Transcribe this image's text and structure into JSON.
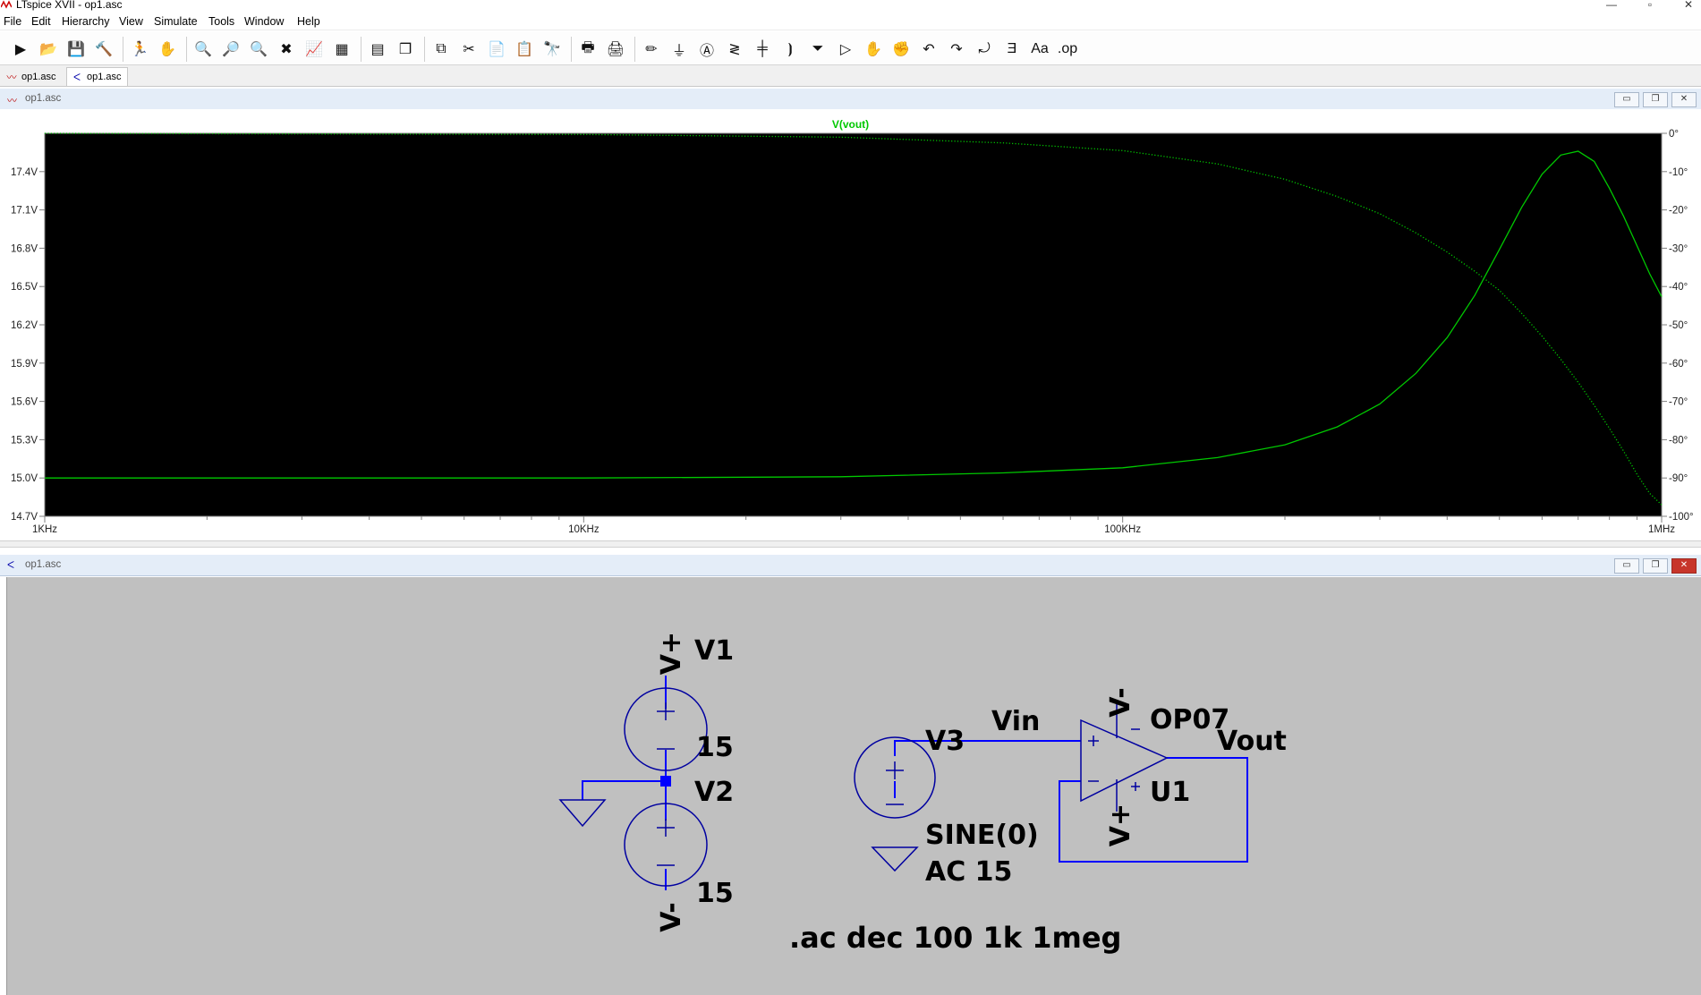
{
  "window": {
    "title": "LTspice XVII - op1.asc"
  },
  "menu": [
    "File",
    "Edit",
    "Hierarchy",
    "View",
    "Simulate",
    "Tools",
    "Window",
    "Help"
  ],
  "toolbar": {
    "buttons": [
      {
        "name": "run",
        "glyph": "▶"
      },
      {
        "name": "open",
        "glyph": "📂"
      },
      {
        "name": "save",
        "glyph": "💾"
      },
      {
        "name": "control-panel",
        "glyph": "🔨"
      },
      {
        "name": "halt",
        "glyph": "🏃"
      },
      {
        "name": "pan",
        "glyph": "✋"
      },
      {
        "name": "zoom-in",
        "glyph": "🔍"
      },
      {
        "name": "zoom-full",
        "glyph": "🔎"
      },
      {
        "name": "zoom-out",
        "glyph": "🔍"
      },
      {
        "name": "zoom-cancel",
        "glyph": "✖"
      },
      {
        "name": "autorange",
        "glyph": "📈"
      },
      {
        "name": "manual-limits",
        "glyph": "▦"
      },
      {
        "name": "tile",
        "glyph": "▤"
      },
      {
        "name": "cascade",
        "glyph": "❐"
      },
      {
        "name": "close-all",
        "glyph": "⧉"
      },
      {
        "name": "cut",
        "glyph": "✂"
      },
      {
        "name": "copy",
        "glyph": "📄"
      },
      {
        "name": "paste",
        "glyph": "📋"
      },
      {
        "name": "find",
        "glyph": "🔭"
      },
      {
        "name": "print-setup",
        "glyph": "🖶"
      },
      {
        "name": "print",
        "glyph": "🖨"
      },
      {
        "name": "wire",
        "glyph": "✏"
      },
      {
        "name": "ground",
        "glyph": "⏚"
      },
      {
        "name": "label-net",
        "glyph": "Ⓐ"
      },
      {
        "name": "resistor",
        "glyph": "≷"
      },
      {
        "name": "capacitor",
        "glyph": "╪"
      },
      {
        "name": "inductor",
        "glyph": "⦘"
      },
      {
        "name": "diode",
        "glyph": "⏷"
      },
      {
        "name": "component",
        "glyph": "▷"
      },
      {
        "name": "move",
        "glyph": "✋"
      },
      {
        "name": "drag",
        "glyph": "✊"
      },
      {
        "name": "undo",
        "glyph": "↶"
      },
      {
        "name": "redo",
        "glyph": "↷"
      },
      {
        "name": "rotate",
        "glyph": "⤾"
      },
      {
        "name": "mirror",
        "glyph": "Ǝ"
      },
      {
        "name": "text",
        "glyph": "Aa"
      },
      {
        "name": "spice-directive",
        "glyph": ".op"
      }
    ]
  },
  "tabs": [
    {
      "label": "op1.asc",
      "kind": "waveform"
    },
    {
      "label": "op1.asc",
      "kind": "schematic"
    }
  ],
  "plot_window": {
    "title": "op1.asc"
  },
  "schematic_window": {
    "title": "op1.asc"
  },
  "colors": {
    "trace": "#00c800",
    "plot_bg": "#000000",
    "schematic_bg": "#c0c0c0",
    "wire": "#0000ff",
    "component": "#0000a0"
  },
  "chart_data": {
    "type": "line",
    "title": "V(vout)",
    "x_scale": "log",
    "xlim": [
      1000,
      1000000
    ],
    "x_ticks": [
      {
        "value": 1000,
        "label": "1KHz"
      },
      {
        "value": 10000,
        "label": "10KHz"
      },
      {
        "value": 100000,
        "label": "100KHz"
      },
      {
        "value": 1000000,
        "label": "1MHz"
      }
    ],
    "ylim": [
      14.7,
      17.7
    ],
    "y_ticks": [
      {
        "value": 17.4,
        "label": "17.4V"
      },
      {
        "value": 17.1,
        "label": "17.1V"
      },
      {
        "value": 16.8,
        "label": "16.8V"
      },
      {
        "value": 16.5,
        "label": "16.5V"
      },
      {
        "value": 16.2,
        "label": "16.2V"
      },
      {
        "value": 15.9,
        "label": "15.9V"
      },
      {
        "value": 15.6,
        "label": "15.6V"
      },
      {
        "value": 15.3,
        "label": "15.3V"
      },
      {
        "value": 15.0,
        "label": "15.0V"
      },
      {
        "value": 14.7,
        "label": "14.7V"
      }
    ],
    "y2lim": [
      -100,
      0
    ],
    "y2_ticks": [
      {
        "value": 0,
        "label": "0°"
      },
      {
        "value": -10,
        "label": "-10°"
      },
      {
        "value": -20,
        "label": "-20°"
      },
      {
        "value": -30,
        "label": "-30°"
      },
      {
        "value": -40,
        "label": "-40°"
      },
      {
        "value": -50,
        "label": "-50°"
      },
      {
        "value": -60,
        "label": "-60°"
      },
      {
        "value": -70,
        "label": "-70°"
      },
      {
        "value": -80,
        "label": "-80°"
      },
      {
        "value": -90,
        "label": "-90°"
      },
      {
        "value": -100,
        "label": "-100°"
      }
    ],
    "series": [
      {
        "name": "magnitude",
        "style": "solid",
        "x": [
          1000,
          10000,
          30000,
          60000,
          100000,
          150000,
          200000,
          250000,
          300000,
          350000,
          400000,
          450000,
          500000,
          550000,
          600000,
          650000,
          700000,
          750000,
          800000,
          850000,
          900000,
          950000,
          1000000
        ],
        "y": [
          15.0,
          15.0,
          15.01,
          15.04,
          15.08,
          15.16,
          15.26,
          15.4,
          15.58,
          15.82,
          16.1,
          16.43,
          16.79,
          17.12,
          17.38,
          17.53,
          17.56,
          17.48,
          17.27,
          17.05,
          16.82,
          16.6,
          16.42
        ]
      },
      {
        "name": "phase",
        "style": "dotted",
        "x": [
          1000,
          10000,
          30000,
          60000,
          100000,
          150000,
          200000,
          250000,
          300000,
          350000,
          400000,
          450000,
          500000,
          550000,
          600000,
          650000,
          700000,
          750000,
          800000,
          850000,
          900000,
          950000,
          1000000
        ],
        "y": [
          0,
          -0.3,
          -1.0,
          -2.5,
          -4.5,
          -8.0,
          -12.0,
          -16.5,
          -21.0,
          -26.0,
          -31.0,
          -36.0,
          -41.0,
          -47.0,
          -53.0,
          -59.0,
          -65.0,
          -71.0,
          -77.0,
          -83.0,
          -89.0,
          -94.0,
          -97.0
        ]
      }
    ]
  },
  "schematic": {
    "labels": {
      "v1_plus": "V+",
      "v1_name": "V1",
      "v1_value": "15",
      "v2_name": "V2",
      "v2_value": "15",
      "v2_minus": "V-",
      "v3_name": "V3",
      "v3_value_line1": "SINE(0)",
      "v3_value_line2": "AC 15",
      "vin": "Vin",
      "opamp_model": "OP07",
      "opamp_name": "U1",
      "opamp_vminus": "V-",
      "opamp_vplus": "V+",
      "vout": "Vout",
      "directive": ".ac dec 100 1k 1meg"
    }
  }
}
